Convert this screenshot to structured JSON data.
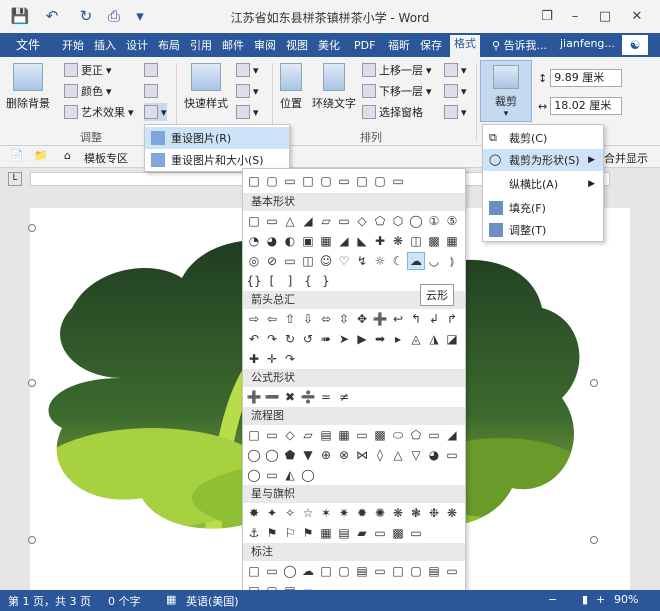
{
  "title_bar": {
    "title": "江苏省如东县栟茶镇栟茶小学 - Word"
  },
  "tabs": {
    "file": "文件",
    "items": [
      "开始",
      "插入",
      "设计",
      "布局",
      "引用",
      "邮件",
      "审阅",
      "视图",
      "美化",
      "PDF",
      "福昕",
      "保存",
      "格式"
    ],
    "active": "格式",
    "tell_me": "告诉我...",
    "user": "jianfeng..."
  },
  "ribbon": {
    "remove_bg": "删除背景",
    "correct": "更正",
    "color": "颜色",
    "artistic": "艺术效果",
    "adjust_group": "调整",
    "quick_styles": "快速样式",
    "position": "位置",
    "wrap_text": "环绕文字",
    "bring_forward": "上移一层",
    "send_backward": "下移一层",
    "selection_pane": "选择窗格",
    "arrange_group": "排列",
    "crop": "裁剪",
    "height": "9.89 厘米",
    "width": "18.02 厘米"
  },
  "reset_menu": {
    "reset_picture": "重设图片(R)",
    "reset_picture_size": "重设图片和大小(S)"
  },
  "doc_bar": {
    "template_zone": "模板专区",
    "merge_display": "合并显示"
  },
  "crop_menu": {
    "crop": "裁剪(C)",
    "crop_to_shape": "裁剪为形状(S)",
    "aspect_ratio": "纵横比(A)",
    "fill": "填充(F)",
    "fit": "调整(T)"
  },
  "gallery": {
    "basic_shapes": "基本形状",
    "block_arrows": "箭头总汇",
    "equation_shapes": "公式形状",
    "flowchart": "流程图",
    "stars_banners": "星与旗帜",
    "callouts": "标注",
    "tooltip": "云形"
  },
  "status_bar": {
    "page": "第 1 页，共 3 页",
    "words": "0 个字",
    "language": "英语(美国)",
    "zoom": "90%"
  },
  "colors": {
    "accent": "#2b579a",
    "highlight": "#cde3f7",
    "ribbon_bg": "#f3f3f3"
  },
  "icons": [
    "save-icon",
    "undo-icon",
    "redo-icon",
    "print-preview-icon",
    "restore-icon",
    "minimize-icon",
    "maximize-icon",
    "close-icon",
    "cloud-shape-icon",
    "crop-icon",
    "fill-icon",
    "fit-icon"
  ]
}
